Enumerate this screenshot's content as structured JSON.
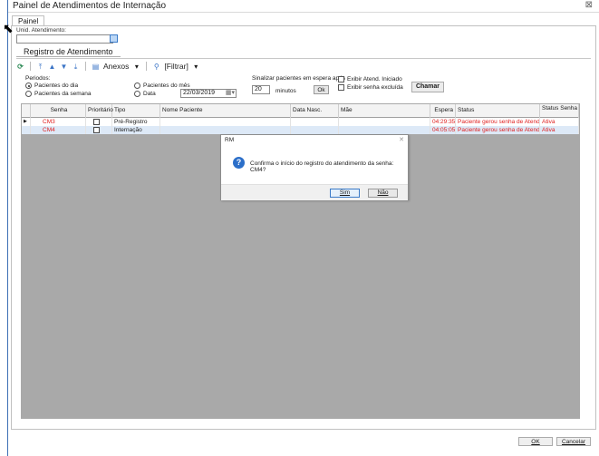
{
  "window": {
    "title": "Painel de Atendimentos de Internação",
    "close": "⊠"
  },
  "tabs": {
    "painel": "Painel",
    "registro": "Registro de Atendimento"
  },
  "unid": {
    "label": "Unid. Atendimento:",
    "value": ""
  },
  "toolbar": {
    "anexos": "Anexos",
    "filtrar": "[Filtrar]"
  },
  "periodos": {
    "label": "Periodos:",
    "options": [
      "Pacientes do dia",
      "Pacientes da semana",
      "Pacientes do mês",
      "Data"
    ],
    "date_value": "22/03/2019"
  },
  "sinalizar": {
    "label": "Sinalizar pacientes em espera após",
    "minutes_value": "20",
    "minutes_label": "minutos",
    "ok": "Ok",
    "exibir_iniciado": "Exibir Atend. Iniciado",
    "exibir_excluida": "Exibir senha excluída",
    "chamar": "Chamar"
  },
  "grid": {
    "headers": [
      "Senha",
      "Prioritário",
      "Tipo",
      "Nome Paciente",
      "Data Nasc.",
      "Mãe",
      "Espera",
      "Status",
      "Status Senha"
    ],
    "rows": [
      {
        "senha": "CM3",
        "tipo": "Pré-Registro",
        "espera": "04:29:35",
        "status": "Paciente gerou senha de Atendimento",
        "status_senha": "Ativa"
      },
      {
        "senha": "CM4",
        "tipo": "Internação",
        "espera": "04:05:05",
        "status": "Paciente gerou senha de Atendimento",
        "status_senha": "Ativa"
      }
    ]
  },
  "dialog": {
    "title": "RM",
    "message": "Confirma o início do registro do atendimento da senha: CM4?",
    "yes": "Sim",
    "no": "Não"
  },
  "footer": {
    "ok": "OK",
    "cancel": "Cancelar"
  }
}
